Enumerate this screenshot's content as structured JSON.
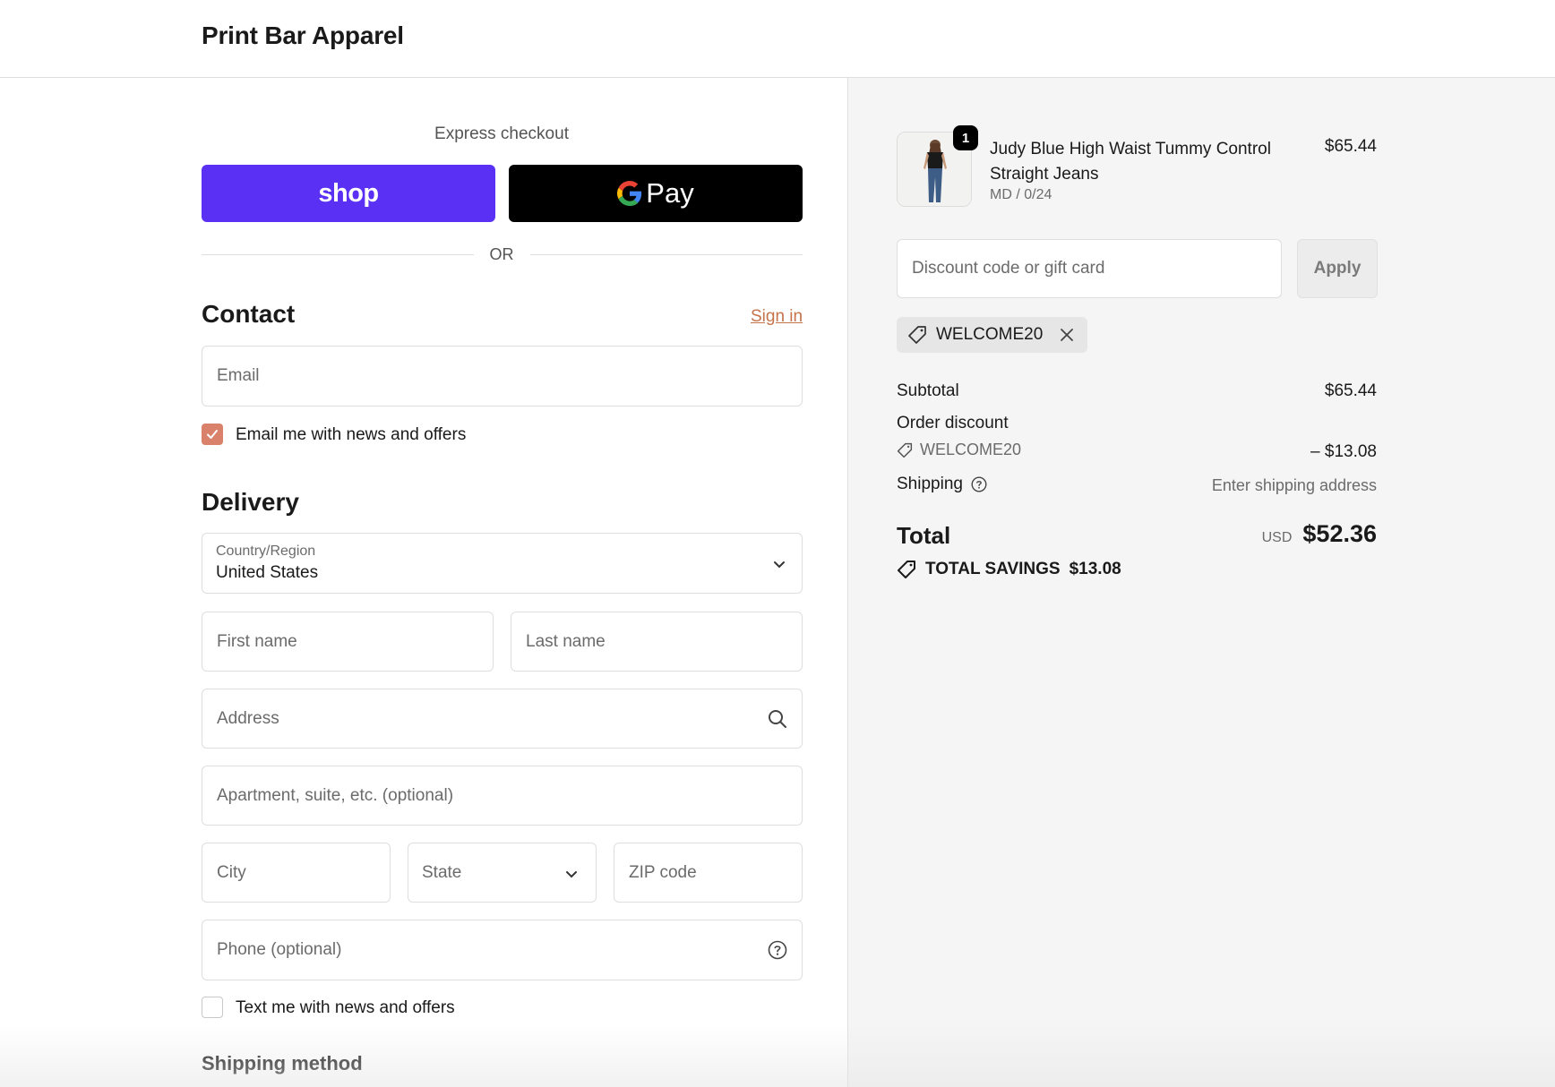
{
  "header": {
    "store_name": "Print Bar Apparel"
  },
  "express": {
    "title": "Express checkout",
    "shop_label": "shop",
    "gpay_label": "Pay",
    "or_label": "OR"
  },
  "contact": {
    "heading": "Contact",
    "sign_in": "Sign in",
    "email_placeholder": "Email",
    "email_value": "",
    "news_checkbox_label": "Email me with news and offers",
    "news_checked": true
  },
  "delivery": {
    "heading": "Delivery",
    "country_label": "Country/Region",
    "country_value": "United States",
    "first_name_placeholder": "First name",
    "last_name_placeholder": "Last name",
    "address_placeholder": "Address",
    "apartment_placeholder": "Apartment, suite, etc. (optional)",
    "city_placeholder": "City",
    "state_value": "State",
    "zip_placeholder": "ZIP code",
    "phone_placeholder": "Phone (optional)",
    "sms_checkbox_label": "Text me with news and offers",
    "sms_checked": false
  },
  "shipping_method": {
    "heading": "Shipping method"
  },
  "summary": {
    "item": {
      "quantity": "1",
      "title_line1": "Judy Blue High Waist Tummy Control",
      "title_line2": "Straight Jeans",
      "variant": "MD / 0/24",
      "price": "$65.44"
    },
    "discount_placeholder": "Discount code or gift card",
    "apply_label": "Apply",
    "applied_code": "WELCOME20",
    "subtotal_label": "Subtotal",
    "subtotal_value": "$65.44",
    "order_discount_label": "Order discount",
    "order_discount_code": "WELCOME20",
    "order_discount_value": "– $13.08",
    "shipping_label": "Shipping",
    "shipping_value": "Enter shipping address",
    "total_label": "Total",
    "currency": "USD",
    "total_value": "$52.36",
    "savings_label": "TOTAL SAVINGS",
    "savings_value": "$13.08"
  },
  "colors": {
    "shop_button": "#5a31f4",
    "gpay_button": "#000000",
    "accent_link": "#c6734b",
    "checkbox_checked": "#d9816b",
    "summary_bg": "#f5f5f5"
  },
  "icons": [
    "tag-icon",
    "close-icon",
    "help-circle-icon",
    "chevron-down-icon",
    "search-icon",
    "check-icon",
    "google-g-icon"
  ]
}
